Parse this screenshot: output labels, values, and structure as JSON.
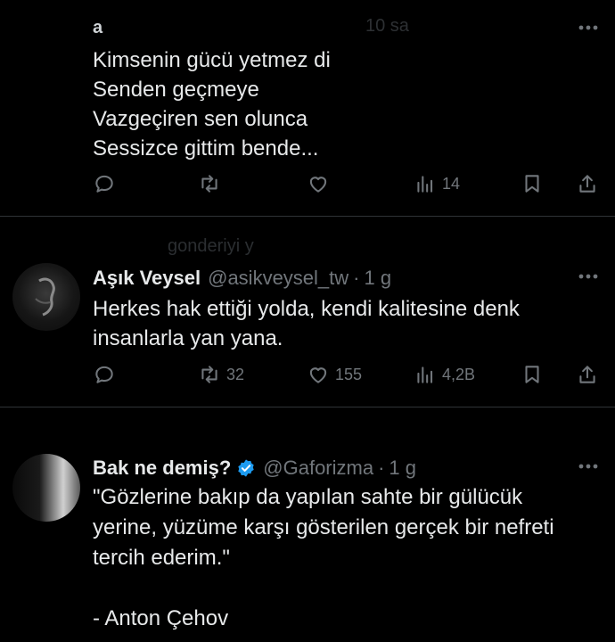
{
  "tweets": [
    {
      "ghost_name": "a",
      "ghost_time": "10 sa",
      "lines": [
        "Kimsenin gücü yetmez di",
        "Senden geçmeye",
        "Vazgeçiren sen olunca",
        "Sessizce gittim bende..."
      ],
      "actions": {
        "reply": "",
        "retweet": "",
        "like": "",
        "views": "14"
      }
    },
    {
      "ghost_context": "gonderiyi y",
      "name": "Aşık Veysel",
      "handle": "@asikveysel_tw",
      "dot": "·",
      "time": "1 g",
      "lines": [
        "Herkes hak ettiği yolda, kendi kalitesine denk",
        "insanlarla yan yana."
      ],
      "actions": {
        "reply": "",
        "retweet": "32",
        "like": "155",
        "views": "4,2B"
      }
    },
    {
      "name": "Bak ne demiş?",
      "handle": "@Gaforizma",
      "dot": "·",
      "time": "1 g",
      "verified": true,
      "lines": [
        "\"Gözlerine bakıp da yapılan sahte bir gülücük",
        "yerine, yüzüme karşı gösterilen gerçek bir nefreti",
        "tercih ederim.\"",
        "",
        "- Anton Çehov"
      ]
    }
  ],
  "colors": {
    "background": "#000000",
    "text": "#e7e9ea",
    "muted": "#71767b",
    "divider": "#2f3336",
    "verified": "#1d9bf0"
  },
  "icons": [
    "reply-icon",
    "retweet-icon",
    "like-icon",
    "views-icon",
    "bookmark-icon",
    "share-icon",
    "more-icon",
    "verified-badge-icon"
  ]
}
